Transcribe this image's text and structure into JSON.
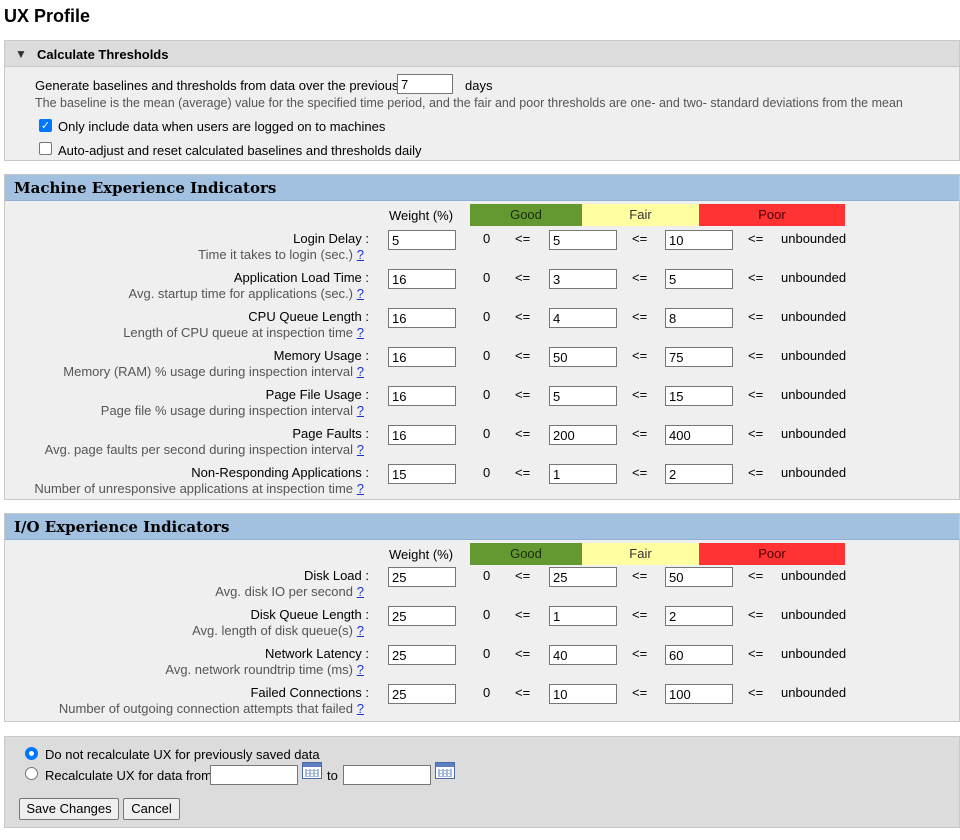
{
  "page": {
    "title": "UX Profile"
  },
  "thresholds": {
    "header": "Calculate Thresholds",
    "baseline_prefix": "Generate baselines and thresholds from data over the previous",
    "days_value": "7",
    "days_label": "days",
    "note": "The baseline is the mean (average) value for the specified time period, and the fair and poor thresholds are one- and two- standard deviations from the mean",
    "opt_logged_on": {
      "label": "Only include data when users are logged on to machines",
      "checked": true
    },
    "opt_auto_adjust": {
      "label": "Auto-adjust and reset calculated baselines and thresholds daily",
      "checked": false
    }
  },
  "columns": {
    "weight": "Weight (%)",
    "good": "Good",
    "fair": "Fair",
    "poor": "Poor",
    "zero": "0",
    "le": "<=",
    "unbounded": "unbounded",
    "help": "?"
  },
  "machine": {
    "title": "Machine Experience Indicators",
    "rows": [
      {
        "label": "Login Delay :",
        "desc": "Time it takes to login (sec.)",
        "weight": "5",
        "good": "5",
        "fair": "10"
      },
      {
        "label": "Application Load Time :",
        "desc": "Avg. startup time for applications (sec.)",
        "weight": "16",
        "good": "3",
        "fair": "5"
      },
      {
        "label": "CPU Queue Length :",
        "desc": "Length of CPU queue at inspection time",
        "weight": "16",
        "good": "4",
        "fair": "8"
      },
      {
        "label": "Memory Usage :",
        "desc": "Memory (RAM) % usage during inspection interval",
        "weight": "16",
        "good": "50",
        "fair": "75"
      },
      {
        "label": "Page File Usage :",
        "desc": "Page file % usage during inspection interval",
        "weight": "16",
        "good": "5",
        "fair": "15"
      },
      {
        "label": "Page Faults :",
        "desc": "Avg. page faults per second during inspection interval",
        "weight": "16",
        "good": "200",
        "fair": "400"
      },
      {
        "label": "Non-Responding Applications :",
        "desc": "Number of unresponsive applications at inspection time",
        "weight": "15",
        "good": "1",
        "fair": "2"
      }
    ]
  },
  "io": {
    "title": "I/O Experience Indicators",
    "rows": [
      {
        "label": "Disk Load :",
        "desc": "Avg. disk IO per second",
        "weight": "25",
        "good": "25",
        "fair": "50"
      },
      {
        "label": "Disk Queue Length :",
        "desc": "Avg. length of disk queue(s)",
        "weight": "25",
        "good": "1",
        "fair": "2"
      },
      {
        "label": "Network Latency :",
        "desc": "Avg. network roundtrip time (ms)",
        "weight": "25",
        "good": "40",
        "fair": "60"
      },
      {
        "label": "Failed Connections :",
        "desc": "Number of outgoing connection attempts that failed",
        "weight": "25",
        "good": "10",
        "fair": "100"
      }
    ]
  },
  "recalc": {
    "opt_no": {
      "label": "Do not recalculate UX for previously saved data",
      "selected": true
    },
    "opt_yes": {
      "label": "Recalculate UX for data from",
      "selected": false
    },
    "from_value": "",
    "to_label": "to",
    "to_value": ""
  },
  "buttons": {
    "save": "Save Changes",
    "cancel": "Cancel"
  },
  "colors": {
    "good": "#649831",
    "fair": "#ffffa2",
    "poor": "#ff3333",
    "section_header": "#a2c1e0",
    "accent": "#0075ff"
  }
}
